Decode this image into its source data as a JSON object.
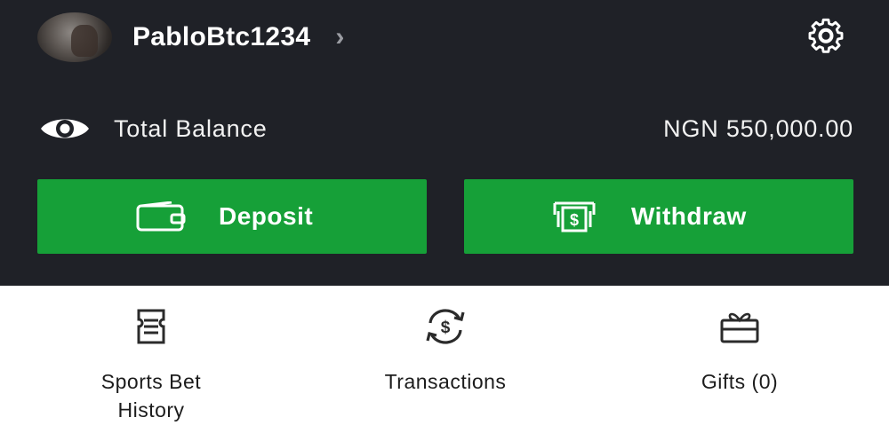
{
  "profile": {
    "username": "PabloBtc1234",
    "chevron_icon": "chevron-right-icon",
    "settings_icon": "gear-icon"
  },
  "balance": {
    "label": "Total Balance",
    "value": "NGN 550,000.00",
    "visibility_icon": "eye-icon"
  },
  "actions": {
    "deposit_label": "Deposit",
    "deposit_icon": "wallet-icon",
    "withdraw_label": "Withdraw",
    "withdraw_icon": "cash-icon"
  },
  "shortcuts": {
    "history_label": "Sports Bet History",
    "history_icon": "receipt-icon",
    "transactions_label": "Transactions",
    "transactions_icon": "dollar-exchange-icon",
    "gifts_label": "Gifts (0)",
    "gifts_icon": "gift-icon"
  },
  "colors": {
    "header_bg": "#1f2127",
    "accent_green": "#16a038",
    "text_light": "#ffffff",
    "text_dark": "#1c1c1c"
  }
}
